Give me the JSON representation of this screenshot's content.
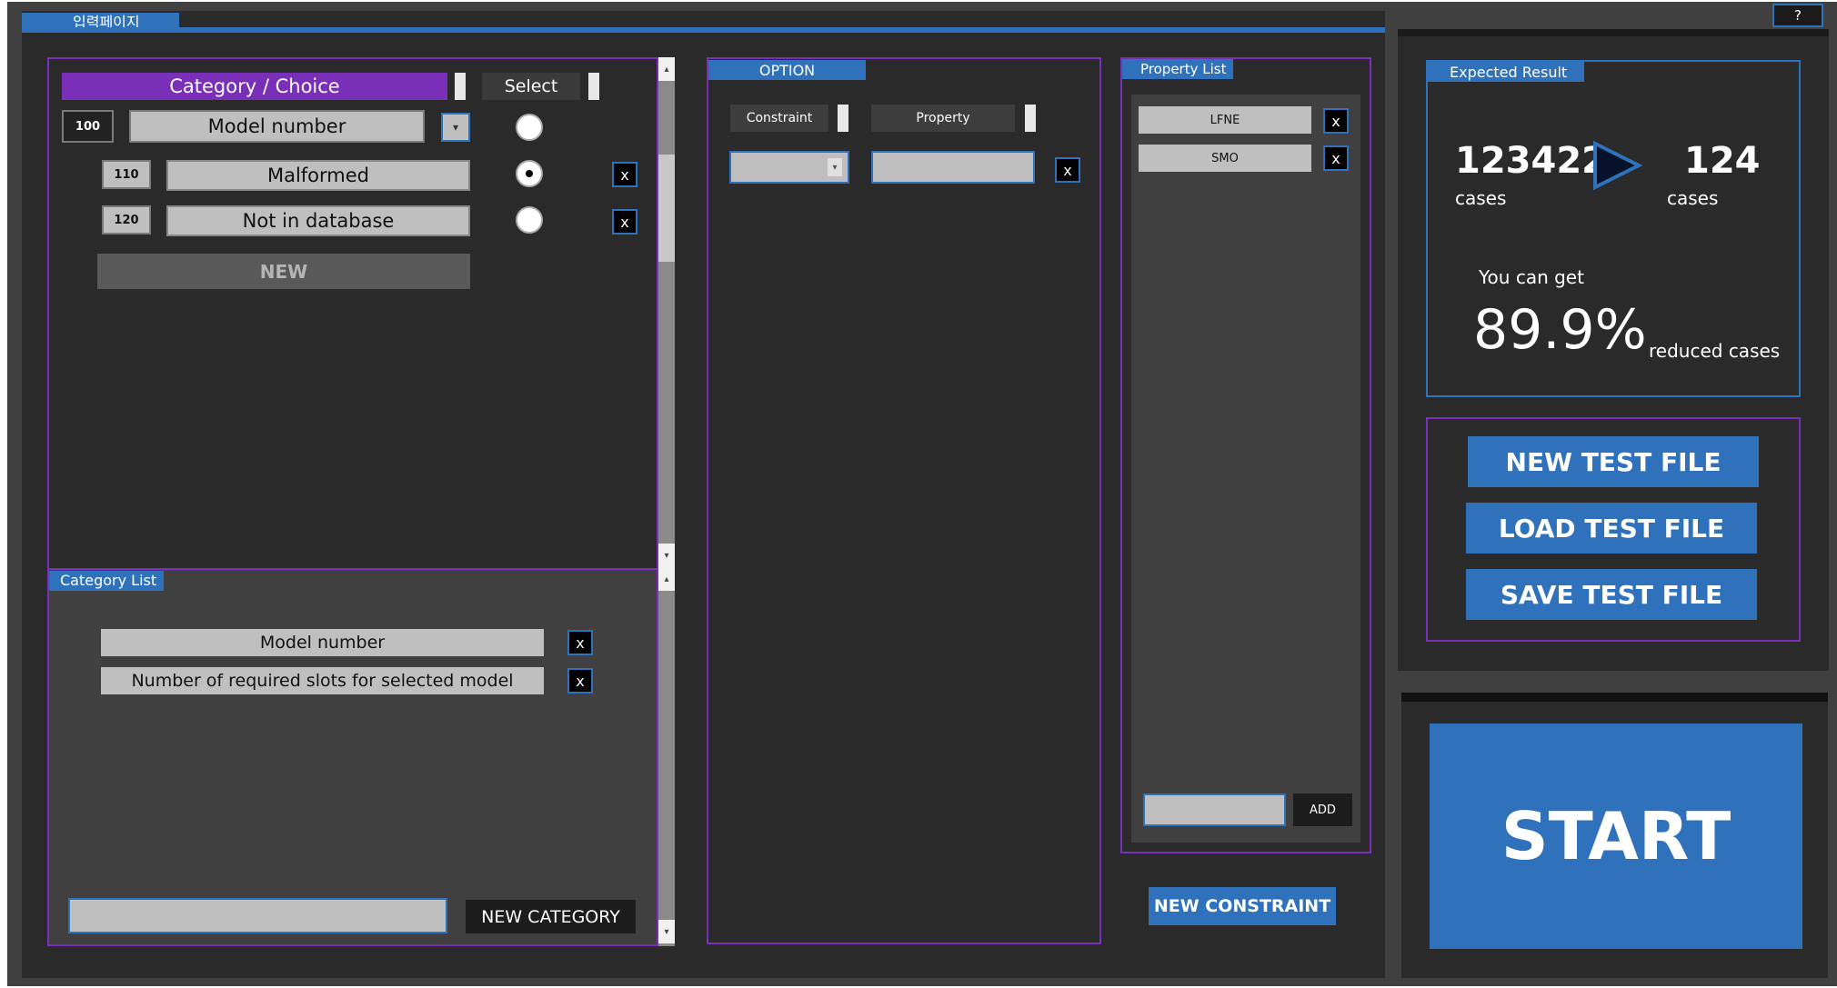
{
  "window": {
    "title_tab": "입력페이지",
    "help_label": "?"
  },
  "category_panel": {
    "header": "Category / Choice",
    "select_header": "Select",
    "category": {
      "id": "100",
      "name": "Model number",
      "dropdown_glyph": "▾"
    },
    "choices": [
      {
        "id": "110",
        "name": "Malformed",
        "selected": false,
        "delete_label": "x"
      },
      {
        "id": "120",
        "name": "Not in database",
        "selected": false,
        "delete_label": "x"
      }
    ],
    "new_label": "NEW"
  },
  "category_list": {
    "title": "Category List",
    "items": [
      {
        "name": "Model number",
        "delete_label": "x"
      },
      {
        "name": "Number of required slots for selected model",
        "delete_label": "x"
      }
    ],
    "input_value": "",
    "new_category_label": "NEW CATEGORY"
  },
  "scrollbar": {
    "up": "▴",
    "down": "▾"
  },
  "option_panel": {
    "title": "OPTION",
    "constraint_header": "Constraint",
    "property_header": "Property",
    "dropdown_glyph": "▾",
    "delete_label": "x"
  },
  "property_list": {
    "title": "Property List",
    "items": [
      {
        "name": "LFNE",
        "delete_label": "x"
      },
      {
        "name": "SMO",
        "delete_label": "x"
      }
    ],
    "add_label": "ADD",
    "new_constraint_label": "NEW CONSTRAINT"
  },
  "expected_result": {
    "title": "Expected Result",
    "before_count": "123422",
    "before_unit": "cases",
    "after_count": "124",
    "after_unit": "cases",
    "you_can_get": "You can get",
    "percent": "89.9%",
    "reduced_label": "reduced cases"
  },
  "file_buttons": {
    "new_label": "NEW TEST FILE",
    "load_label": "LOAD TEST FILE",
    "save_label": "SAVE TEST FILE"
  },
  "start_label": "START",
  "colors": {
    "accent_blue": "#2f72bb",
    "purple": "#7a2fb8",
    "panel_dark": "#2a2a2a",
    "frame": "#404040"
  }
}
